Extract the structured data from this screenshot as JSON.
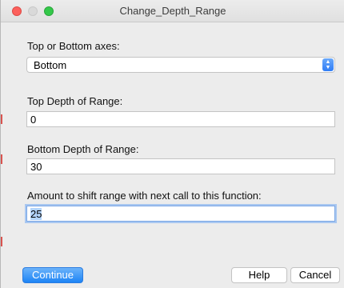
{
  "window": {
    "title": "Change_Depth_Range"
  },
  "form": {
    "axes_label": "Top or Bottom axes:",
    "axes_value": "Bottom",
    "top_depth_label": "Top Depth of Range:",
    "top_depth_value": "0",
    "bottom_depth_label": "Bottom Depth of Range:",
    "bottom_depth_value": "30",
    "shift_label": "Amount to shift range with next call to this function:",
    "shift_value": "25"
  },
  "buttons": {
    "continue_label": "Continue",
    "help_label": "Help",
    "cancel_label": "Cancel"
  },
  "colors": {
    "accent": "#2f7df6",
    "close": "#fc605c",
    "zoom": "#34c84a"
  }
}
